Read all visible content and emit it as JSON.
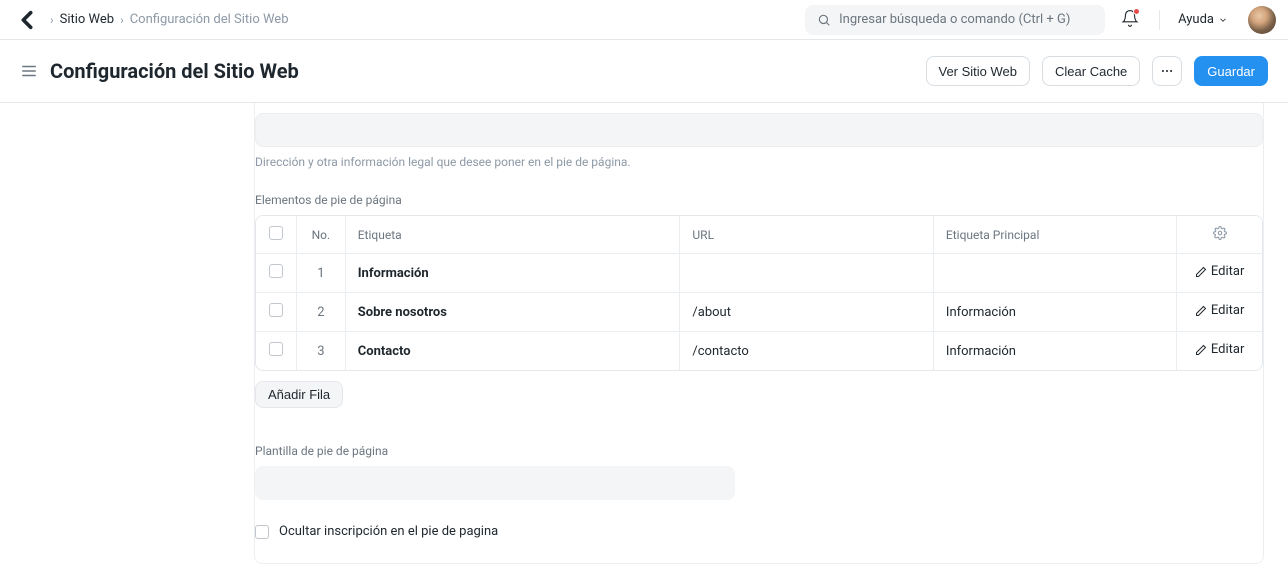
{
  "topbar": {
    "breadcrumb": {
      "level1": "Sitio Web",
      "current": "Configuración del Sitio Web"
    },
    "search_placeholder": "Ingresar búsqueda o comando (Ctrl + G)",
    "help_label": "Ayuda"
  },
  "page": {
    "title": "Configuración del Sitio Web",
    "buttons": {
      "view_site": "Ver Sitio Web",
      "clear_cache": "Clear Cache",
      "save": "Guardar"
    }
  },
  "footer_section": {
    "help_text": "Dirección y otra información legal que desee poner en el pie de página.",
    "label": "Elementos de pie de página",
    "columns": {
      "no": "No.",
      "label": "Etiqueta",
      "url": "URL",
      "parent": "Etiqueta Principal"
    },
    "edit_label": "Editar",
    "rows": [
      {
        "no": "1",
        "label": "Información",
        "url": "",
        "parent": ""
      },
      {
        "no": "2",
        "label": "Sobre nosotros",
        "url": "/about",
        "parent": "Información"
      },
      {
        "no": "3",
        "label": "Contacto",
        "url": "/contacto",
        "parent": "Información"
      }
    ],
    "add_row": "Añadir Fila"
  },
  "template_section": {
    "label": "Plantilla de pie de página",
    "hide_subscription": "Ocultar inscripción en el pie de pagina"
  }
}
